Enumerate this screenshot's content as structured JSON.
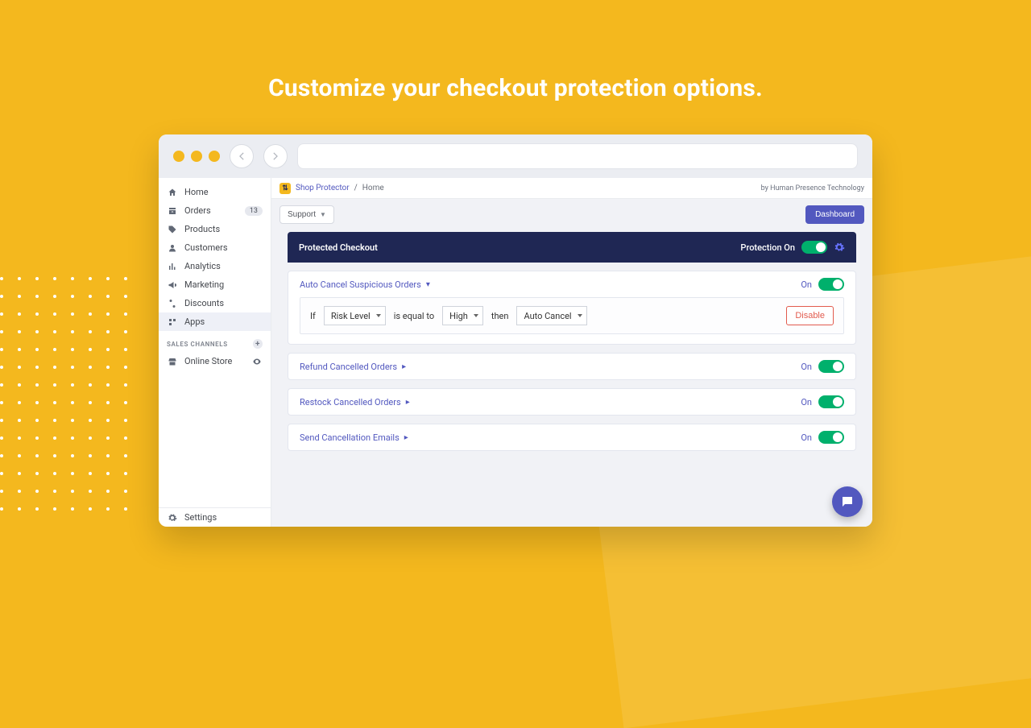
{
  "headline": "Customize your checkout protection options.",
  "sidebar": {
    "items": [
      {
        "label": "Home"
      },
      {
        "label": "Orders",
        "badge": "13"
      },
      {
        "label": "Products"
      },
      {
        "label": "Customers"
      },
      {
        "label": "Analytics"
      },
      {
        "label": "Marketing"
      },
      {
        "label": "Discounts"
      },
      {
        "label": "Apps"
      }
    ],
    "channels_heading": "SALES CHANNELS",
    "channels": [
      {
        "label": "Online Store"
      }
    ],
    "settings": "Settings"
  },
  "crumb": {
    "app": "Shop Protector",
    "page": "Home",
    "byline": "by Human Presence Technology"
  },
  "toolbar": {
    "support": "Support",
    "dashboard": "Dashboard"
  },
  "panel": {
    "title": "Protected Checkout",
    "protection_label": "Protection On"
  },
  "rules": {
    "if": "If",
    "field": "Risk Level",
    "op": "is equal to",
    "value": "High",
    "then": "then",
    "action": "Auto Cancel",
    "disable": "Disable"
  },
  "cards": [
    {
      "title": "Auto Cancel Suspicious Orders",
      "state": "On",
      "expanded": true
    },
    {
      "title": "Refund Cancelled Orders",
      "state": "On",
      "expanded": false
    },
    {
      "title": "Restock Cancelled Orders",
      "state": "On",
      "expanded": false
    },
    {
      "title": "Send Cancellation Emails",
      "state": "On",
      "expanded": false
    }
  ]
}
